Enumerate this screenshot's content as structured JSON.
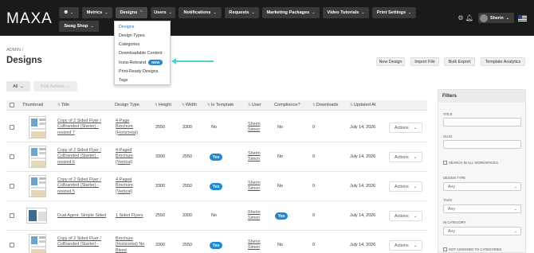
{
  "nav": {
    "logo": "MAXA",
    "items": [
      {
        "label": "Metrics"
      },
      {
        "label": "Designs"
      },
      {
        "label": "Users"
      },
      {
        "label": "Notifications"
      },
      {
        "label": "Requests"
      },
      {
        "label": "Marketing Packages"
      },
      {
        "label": "Video Tutorials"
      },
      {
        "label": "Print Settings"
      },
      {
        "label": "Swag Shop"
      }
    ],
    "user": "Sherin"
  },
  "dropdown": {
    "items": [
      {
        "label": "Designs"
      },
      {
        "label": "Design Types"
      },
      {
        "label": "Categories"
      },
      {
        "label": "Downloadable Content"
      },
      {
        "label": "Insta-Rebrand",
        "badge": "NEW"
      },
      {
        "label": "Print-Ready Designs"
      },
      {
        "label": "Tags"
      }
    ]
  },
  "breadcrumb": "ADMIN /",
  "page_title": "Designs",
  "actions": {
    "new_design": "New Design",
    "import_file": "Import File",
    "bulk_export": "Bulk Export",
    "template_analytics": "Template Analytics"
  },
  "toolbar": {
    "all": "All",
    "bulk_actions": "Bulk Actions"
  },
  "table": {
    "headers": {
      "thumbnail": "Thumbnail",
      "title": "Title",
      "design_type": "Design Type",
      "height": "Height",
      "width": "Width",
      "is_template": "Is Template",
      "user": "User",
      "compliance": "Compliance?",
      "downloads": "Downloads",
      "updated_at": "Updated At"
    },
    "rows": [
      {
        "title": "Copy of 2 Sided Flyer / CoBranded (Starter) - resized 7",
        "design_type": "4-Page Brochure (Horizontal)",
        "height": "2550",
        "width": "3300",
        "is_template": "No",
        "user": "Sherin Simon",
        "compliance": "No",
        "downloads": "0",
        "updated": "July 14, 2026",
        "actions": "Actions"
      },
      {
        "title": "Copy of 2 Sided Flyer / CoBranded (Starter) - resized 6",
        "design_type": "4-Paged Brochure (Vertical)",
        "height": "3300",
        "width": "2550",
        "is_template": "Yes",
        "user": "Sherin Simon",
        "compliance": "No",
        "downloads": "0",
        "updated": "July 14, 2026",
        "actions": "Actions"
      },
      {
        "title": "Copy of 2 Sided Flyer / CoBranded (Starter) - resized 5",
        "design_type": "4-Paged Brochure (Vertical)",
        "height": "3300",
        "width": "2550",
        "is_template": "Yes",
        "user": "Sherin Simon",
        "compliance": "No",
        "downloads": "0",
        "updated": "July 14, 2026",
        "actions": "Actions"
      },
      {
        "title": "Dual Agent, Simple Sided",
        "design_type": "1 Sided Flyers",
        "height": "2550",
        "width": "3300",
        "is_template": "No",
        "user": "Sherin Simon",
        "compliance": "Yes",
        "downloads": "0",
        "updated": "July 14, 2026",
        "actions": "Actions"
      },
      {
        "title": "Copy of 2 Sided Flyer / CoBranded (Starter) -",
        "design_type": "Brochure (Horizontal) No Bleed",
        "height": "3300",
        "width": "2550",
        "is_template": "Yes",
        "user": "Sherin Simon",
        "compliance": "No",
        "downloads": "0",
        "updated": "July 14, 2026",
        "actions": "Actions"
      }
    ]
  },
  "filters": {
    "heading": "Filters",
    "title_label": "TITLE",
    "slug_label": "SLUG",
    "search_all_label": "SEARCH IN ALL WORKSPACES",
    "design_type_label": "DESIGN TYPE",
    "design_type_value": "Any",
    "tags_label": "TAGS",
    "tags_value": "Any",
    "category_label": "IN CATEGORY",
    "category_value": "Any",
    "not_assigned_label": "NOT ASSIGNED TO CATEGORIES"
  }
}
